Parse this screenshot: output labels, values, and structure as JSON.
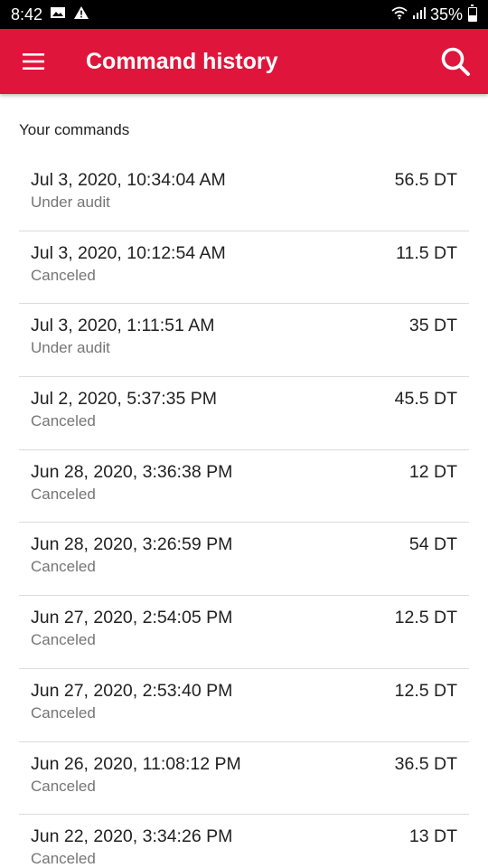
{
  "status_bar": {
    "time": "8:42",
    "battery": "35%",
    "icons": [
      "image-icon",
      "warning-icon",
      "wifi-icon",
      "signal-icon",
      "battery-icon"
    ]
  },
  "app_bar": {
    "title": "Command history",
    "color": "#e0153b",
    "menu_icon": "menu-icon",
    "search_icon": "search-icon"
  },
  "section_label": "Your commands",
  "commands": [
    {
      "date": "Jul 3, 2020, 10:34:04 AM",
      "status": "Under audit",
      "amount": "56.5 DT"
    },
    {
      "date": "Jul 3, 2020, 10:12:54 AM",
      "status": "Canceled",
      "amount": "11.5 DT"
    },
    {
      "date": "Jul 3, 2020, 1:11:51 AM",
      "status": "Under audit",
      "amount": "35 DT"
    },
    {
      "date": "Jul 2, 2020, 5:37:35 PM",
      "status": "Canceled",
      "amount": "45.5 DT"
    },
    {
      "date": "Jun 28, 2020, 3:36:38 PM",
      "status": "Canceled",
      "amount": "12 DT"
    },
    {
      "date": "Jun 28, 2020, 3:26:59 PM",
      "status": "Canceled",
      "amount": "54 DT"
    },
    {
      "date": "Jun 27, 2020, 2:54:05 PM",
      "status": "Canceled",
      "amount": "12.5 DT"
    },
    {
      "date": "Jun 27, 2020, 2:53:40 PM",
      "status": "Canceled",
      "amount": "12.5 DT"
    },
    {
      "date": "Jun 26, 2020, 11:08:12 PM",
      "status": "Canceled",
      "amount": "36.5 DT"
    },
    {
      "date": "Jun 22, 2020, 3:34:26 PM",
      "status": "Canceled",
      "amount": "13 DT"
    }
  ]
}
